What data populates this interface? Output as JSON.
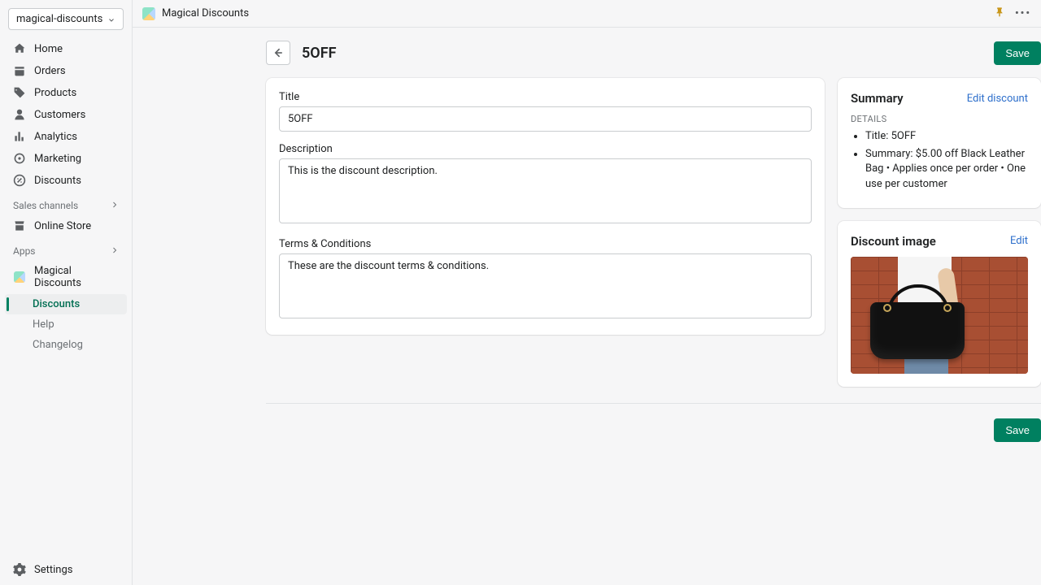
{
  "store": {
    "name": "magical-discounts"
  },
  "topbar": {
    "app_name": "Magical Discounts"
  },
  "nav": {
    "home": "Home",
    "orders": "Orders",
    "products": "Products",
    "customers": "Customers",
    "analytics": "Analytics",
    "marketing": "Marketing",
    "discounts": "Discounts",
    "sales_channels": "Sales channels",
    "online_store": "Online Store",
    "apps": "Apps",
    "app_magical": "Magical Discounts",
    "sub_discounts": "Discounts",
    "sub_help": "Help",
    "sub_changelog": "Changelog",
    "settings": "Settings"
  },
  "page": {
    "title": "5OFF",
    "save": "Save"
  },
  "form": {
    "title_label": "Title",
    "title_value": "5OFF",
    "description_label": "Description",
    "description_value": "This is the discount description.",
    "terms_label": "Terms & Conditions",
    "terms_value": "These are the discount terms & conditions."
  },
  "summary": {
    "heading": "Summary",
    "edit": "Edit discount",
    "details_label": "DETAILS",
    "line_title": "Title: 5OFF",
    "line_summary": "Summary: $5.00 off Black Leather Bag • Applies once per order • One use per customer"
  },
  "image_card": {
    "heading": "Discount image",
    "edit": "Edit"
  }
}
